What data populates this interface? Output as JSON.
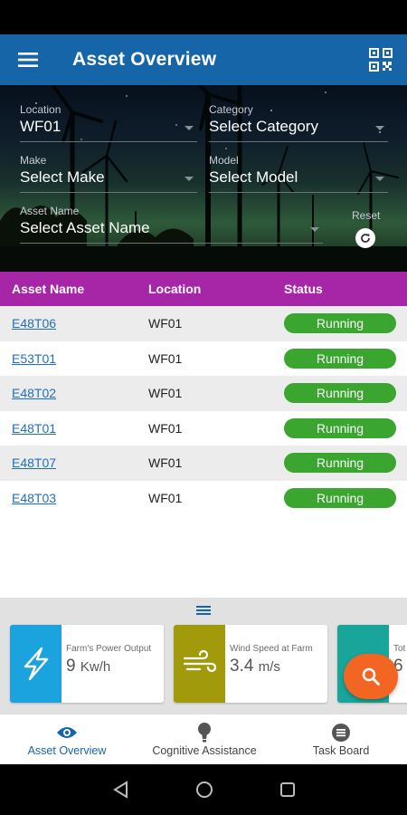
{
  "app_bar": {
    "title": "Asset Overview",
    "menu_icon": "menu-icon",
    "qr_icon": "qr-code-icon"
  },
  "filters": {
    "location": {
      "label": "Location",
      "value": "WF01"
    },
    "category": {
      "label": "Category",
      "value": "Select Category"
    },
    "make": {
      "label": "Make",
      "value": "Select Make"
    },
    "model": {
      "label": "Model",
      "value": "Select Model"
    },
    "asset_name": {
      "label": "Asset Name",
      "value": "Select Asset Name"
    },
    "reset_label": "Reset"
  },
  "table": {
    "headers": [
      "Asset Name",
      "Location",
      "Status"
    ],
    "rows": [
      {
        "asset": "E48T06",
        "location": "WF01",
        "status": "Running"
      },
      {
        "asset": "E53T01",
        "location": "WF01",
        "status": "Running"
      },
      {
        "asset": "E48T02",
        "location": "WF01",
        "status": "Running"
      },
      {
        "asset": "E48T01",
        "location": "WF01",
        "status": "Running"
      },
      {
        "asset": "E48T07",
        "location": "WF01",
        "status": "Running"
      },
      {
        "asset": "E48T03",
        "location": "WF01",
        "status": "Running"
      }
    ]
  },
  "cards": [
    {
      "label": "Farm's Power Output",
      "value": "9",
      "unit": "Kw/h",
      "icon": "lightning-icon",
      "color": "#1aa3dc"
    },
    {
      "label": "Wind Speed at Farm",
      "value": "3.4",
      "unit": "m/s",
      "icon": "wind-icon",
      "color": "#a19a0a"
    },
    {
      "label": "Tot",
      "value": "6",
      "unit": "",
      "icon": "partial-icon",
      "color": "#1aa59a"
    }
  ],
  "bottom_nav": [
    {
      "label": "Asset Overview",
      "icon": "eye-icon",
      "active": true
    },
    {
      "label": "Cognitive Assistance",
      "icon": "lightbulb-icon",
      "active": false
    },
    {
      "label": "Task Board",
      "icon": "list-icon",
      "active": false
    }
  ],
  "colors": {
    "app_bar": "#1565a8",
    "table_header": "#a726a8",
    "status_running": "#3aa52f",
    "fab": "#f26522",
    "nav_active": "#1565a8"
  }
}
